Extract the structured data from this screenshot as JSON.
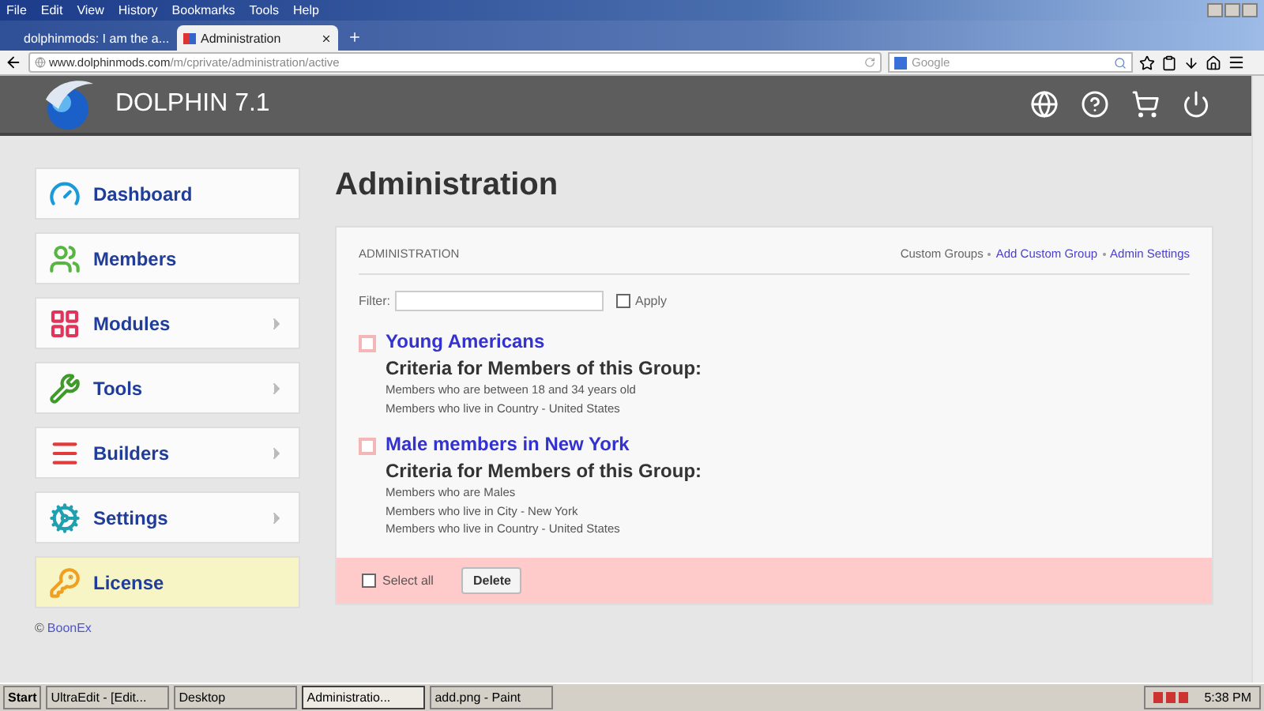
{
  "browser": {
    "menu": [
      "File",
      "Edit",
      "View",
      "History",
      "Bookmarks",
      "Tools",
      "Help"
    ],
    "tabs": [
      {
        "label": "dolphinmods: I am the a...",
        "selected": false
      },
      {
        "label": "Administration",
        "selected": true
      }
    ],
    "url_host": "www.dolphinmods.com",
    "url_path": "/m/cprivate/administration/active",
    "search_placeholder": "Google"
  },
  "site": {
    "title": "DOLPHIN 7.1"
  },
  "sidebar": {
    "items": [
      {
        "label": "Dashboard",
        "kind": "dashboard",
        "expandable": false,
        "selected": false
      },
      {
        "label": "Members",
        "kind": "members",
        "expandable": false,
        "selected": false
      },
      {
        "label": "Modules",
        "kind": "modules",
        "expandable": true,
        "selected": false
      },
      {
        "label": "Tools",
        "kind": "tools",
        "expandable": true,
        "selected": false
      },
      {
        "label": "Builders",
        "kind": "builders",
        "expandable": true,
        "selected": false
      },
      {
        "label": "Settings",
        "kind": "settings",
        "expandable": true,
        "selected": false
      },
      {
        "label": "License",
        "kind": "license",
        "expandable": false,
        "selected": true
      }
    ],
    "copyright": "©",
    "link": "BoonEx"
  },
  "page_title": "Administration",
  "panel": {
    "heading": "ADMINISTRATION",
    "links": [
      {
        "label": "Custom Groups",
        "selected": true
      },
      {
        "label": "Add Custom Group",
        "selected": false
      },
      {
        "label": "Admin Settings",
        "selected": false
      }
    ],
    "filter": {
      "label": "Filter:"
    },
    "apply": {
      "label": "Apply",
      "checked": false
    },
    "groups": [
      {
        "name": "Young Americans",
        "checked": false,
        "criteria_title": "Criteria for Members of this Group:",
        "criteria": [
          "Members who are between 18 and 34 years old",
          "Members who live in Country - United States"
        ]
      },
      {
        "name": "Male members in New York",
        "checked": false,
        "criteria_title": "Criteria for Members of this Group:",
        "criteria": [
          "Members who are Males",
          "Members who live in City - New York",
          "Members who live in Country - United States"
        ]
      }
    ],
    "select_all": {
      "label": "Select all",
      "checked": false
    },
    "delete_button": "Delete"
  },
  "taskbar": {
    "start": "Start",
    "tasks": [
      {
        "label": "UltraEdit - [Edit...",
        "selected": false
      },
      {
        "label": "Desktop",
        "selected": false
      },
      {
        "label": "Administratio...",
        "selected": true
      },
      {
        "label": "add.png - Paint",
        "selected": false
      }
    ],
    "clock": "5:38 PM"
  }
}
